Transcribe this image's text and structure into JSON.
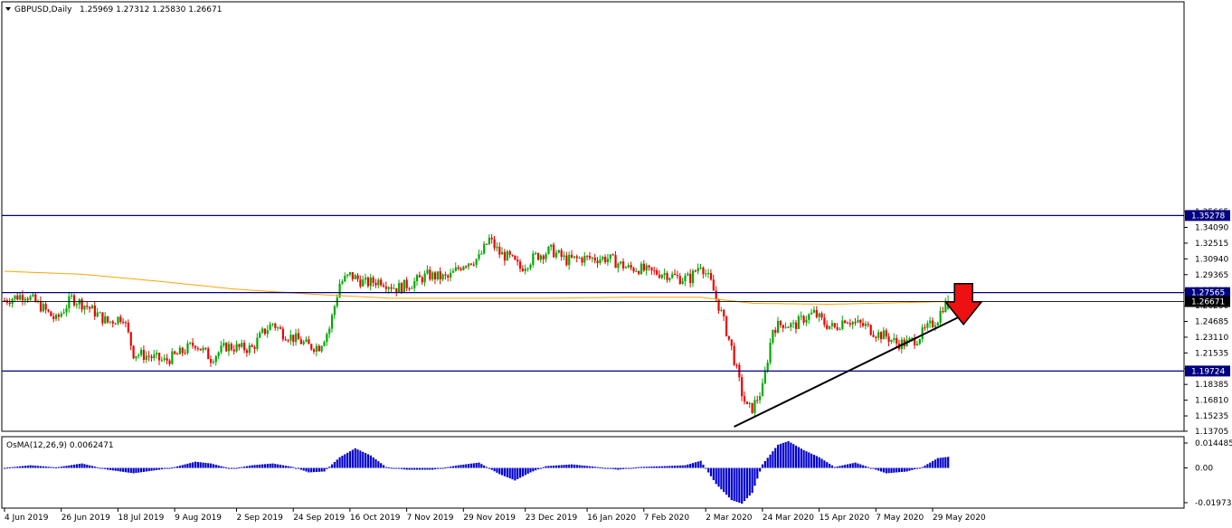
{
  "header": {
    "symbol": "GBPUSD,Daily",
    "ohlc": "1.25969 1.27312 1.25830 1.26671"
  },
  "indicator": {
    "label": "OsMA(12,26,9) 0.0062471"
  },
  "colors": {
    "bull": "#00aa00",
    "bear": "#ee0000",
    "hline": "#000080",
    "ma": "#ffa500",
    "osma": "#0000cc",
    "trend": "#000000",
    "arrow": "#ee1111"
  },
  "chart_data": [
    {
      "type": "candlestick",
      "title": "",
      "ylim": [
        1.137,
        1.5665
      ],
      "y_ticks": [
        "1.35665",
        "1.34090",
        "1.32515",
        "1.30940",
        "1.29365",
        "1.27790",
        "1.26260",
        "1.24685",
        "1.23110",
        "1.21535",
        "1.19960",
        "1.18385",
        "1.16810",
        "1.15235",
        "1.13705"
      ],
      "x_ticks": [
        {
          "label": "4 Jun 2019",
          "day": 0
        },
        {
          "label": "26 Jun 2019",
          "day": 22
        },
        {
          "label": "18 Jul 2019",
          "day": 44
        },
        {
          "label": "9 Aug 2019",
          "day": 66
        },
        {
          "label": "2 Sep 2019",
          "day": 90
        },
        {
          "label": "24 Sep 2019",
          "day": 112
        },
        {
          "label": "16 Oct 2019",
          "day": 134
        },
        {
          "label": "7 Nov 2019",
          "day": 156
        },
        {
          "label": "29 Nov 2019",
          "day": 178
        },
        {
          "label": "23 Dec 2019",
          "day": 202
        },
        {
          "label": "16 Jan 2020",
          "day": 226
        },
        {
          "label": "7 Feb 2020",
          "day": 248
        },
        {
          "label": "2 Mar 2020",
          "day": 272
        },
        {
          "label": "24 Mar 2020",
          "day": 294
        },
        {
          "label": "15 Apr 2020",
          "day": 316
        },
        {
          "label": "7 May 2020",
          "day": 338
        },
        {
          "label": "29 May 2020",
          "day": 360
        }
      ],
      "horizontal_levels": [
        {
          "value": 1.35278,
          "label": "1.35278",
          "style": "line"
        },
        {
          "value": 1.27565,
          "label": "1.27565",
          "style": "line"
        },
        {
          "value": 1.26671,
          "label": "1.26671",
          "style": "price"
        },
        {
          "value": 1.19724,
          "label": "1.19724",
          "style": "line"
        }
      ],
      "trendline": [
        {
          "day": 283,
          "price": 1.1415
        },
        {
          "day": 374,
          "price": 1.256
        }
      ],
      "arrow": {
        "day": 372,
        "price": 1.262,
        "direction": "down"
      },
      "anchors": [
        [
          0,
          1.268
        ],
        [
          8,
          1.274
        ],
        [
          14,
          1.262
        ],
        [
          20,
          1.248
        ],
        [
          26,
          1.27
        ],
        [
          32,
          1.262
        ],
        [
          40,
          1.246
        ],
        [
          46,
          1.252
        ],
        [
          50,
          1.215
        ],
        [
          56,
          1.212
        ],
        [
          62,
          1.207
        ],
        [
          68,
          1.215
        ],
        [
          74,
          1.225
        ],
        [
          80,
          1.21
        ],
        [
          86,
          1.222
        ],
        [
          92,
          1.22
        ],
        [
          96,
          1.22
        ],
        [
          100,
          1.235
        ],
        [
          104,
          1.245
        ],
        [
          108,
          1.235
        ],
        [
          114,
          1.228
        ],
        [
          118,
          1.222
        ],
        [
          122,
          1.222
        ],
        [
          126,
          1.24
        ],
        [
          130,
          1.285
        ],
        [
          134,
          1.293
        ],
        [
          140,
          1.285
        ],
        [
          146,
          1.288
        ],
        [
          152,
          1.28
        ],
        [
          158,
          1.285
        ],
        [
          164,
          1.293
        ],
        [
          172,
          1.29
        ],
        [
          178,
          1.305
        ],
        [
          184,
          1.31
        ],
        [
          188,
          1.329
        ],
        [
          192,
          1.315
        ],
        [
          196,
          1.31
        ],
        [
          200,
          1.3
        ],
        [
          206,
          1.312
        ],
        [
          212,
          1.318
        ],
        [
          218,
          1.308
        ],
        [
          224,
          1.31
        ],
        [
          230,
          1.31
        ],
        [
          234,
          1.31
        ],
        [
          238,
          1.305
        ],
        [
          242,
          1.3
        ],
        [
          246,
          1.3
        ],
        [
          250,
          1.296
        ],
        [
          256,
          1.295
        ],
        [
          262,
          1.29
        ],
        [
          266,
          1.29
        ],
        [
          270,
          1.305
        ],
        [
          274,
          1.285
        ],
        [
          278,
          1.255
        ],
        [
          282,
          1.22
        ],
        [
          286,
          1.175
        ],
        [
          288,
          1.16
        ],
        [
          290,
          1.16
        ],
        [
          294,
          1.18
        ],
        [
          298,
          1.24
        ],
        [
          302,
          1.245
        ],
        [
          306,
          1.242
        ],
        [
          310,
          1.25
        ],
        [
          314,
          1.255
        ],
        [
          318,
          1.245
        ],
        [
          322,
          1.24
        ],
        [
          326,
          1.25
        ],
        [
          330,
          1.245
        ],
        [
          334,
          1.242
        ],
        [
          338,
          1.235
        ],
        [
          342,
          1.232
        ],
        [
          346,
          1.225
        ],
        [
          350,
          1.225
        ],
        [
          354,
          1.23
        ],
        [
          358,
          1.24
        ],
        [
          362,
          1.25
        ],
        [
          364,
          1.262
        ],
        [
          366,
          1.2667
        ]
      ],
      "ma_points": [
        [
          0,
          1.297
        ],
        [
          30,
          1.294
        ],
        [
          60,
          1.287
        ],
        [
          90,
          1.279
        ],
        [
          120,
          1.274
        ],
        [
          150,
          1.27
        ],
        [
          180,
          1.27
        ],
        [
          210,
          1.27
        ],
        [
          240,
          1.271
        ],
        [
          270,
          1.271
        ],
        [
          290,
          1.265
        ],
        [
          320,
          1.264
        ],
        [
          366,
          1.2667
        ]
      ]
    },
    {
      "type": "bar",
      "title": "OsMA(12,26,9)",
      "ylim": [
        -0.0225,
        0.0175
      ],
      "y_ticks": [
        "0.0144858",
        "0.00",
        "-0.0197354"
      ],
      "anchors": [
        [
          0,
          0.0
        ],
        [
          10,
          0.0015
        ],
        [
          20,
          0.0003
        ],
        [
          30,
          0.0025
        ],
        [
          40,
          -0.001
        ],
        [
          50,
          -0.003
        ],
        [
          60,
          -0.001
        ],
        [
          66,
          0.0005
        ],
        [
          74,
          0.0035
        ],
        [
          80,
          0.0025
        ],
        [
          88,
          -0.0005
        ],
        [
          96,
          0.0015
        ],
        [
          104,
          0.0025
        ],
        [
          112,
          0.0005
        ],
        [
          118,
          -0.0025
        ],
        [
          124,
          -0.002
        ],
        [
          130,
          0.006
        ],
        [
          136,
          0.011
        ],
        [
          142,
          0.007
        ],
        [
          148,
          0.0005
        ],
        [
          156,
          -0.001
        ],
        [
          166,
          -0.001
        ],
        [
          176,
          0.0015
        ],
        [
          184,
          0.003
        ],
        [
          192,
          -0.0035
        ],
        [
          198,
          -0.007
        ],
        [
          204,
          -0.0025
        ],
        [
          210,
          0.001
        ],
        [
          220,
          0.002
        ],
        [
          230,
          0.0005
        ],
        [
          238,
          -0.001
        ],
        [
          246,
          0.0005
        ],
        [
          256,
          0.001
        ],
        [
          264,
          0.0015
        ],
        [
          270,
          0.004
        ],
        [
          276,
          -0.009
        ],
        [
          282,
          -0.018
        ],
        [
          286,
          -0.02
        ],
        [
          290,
          -0.014
        ],
        [
          294,
          0.002
        ],
        [
          300,
          0.013
        ],
        [
          304,
          0.015
        ],
        [
          310,
          0.01
        ],
        [
          316,
          0.006
        ],
        [
          322,
          0.0005
        ],
        [
          330,
          0.003
        ],
        [
          336,
          0.0
        ],
        [
          342,
          -0.003
        ],
        [
          350,
          -0.002
        ],
        [
          356,
          0.0005
        ],
        [
          362,
          0.0055
        ],
        [
          366,
          0.0062
        ]
      ]
    }
  ]
}
